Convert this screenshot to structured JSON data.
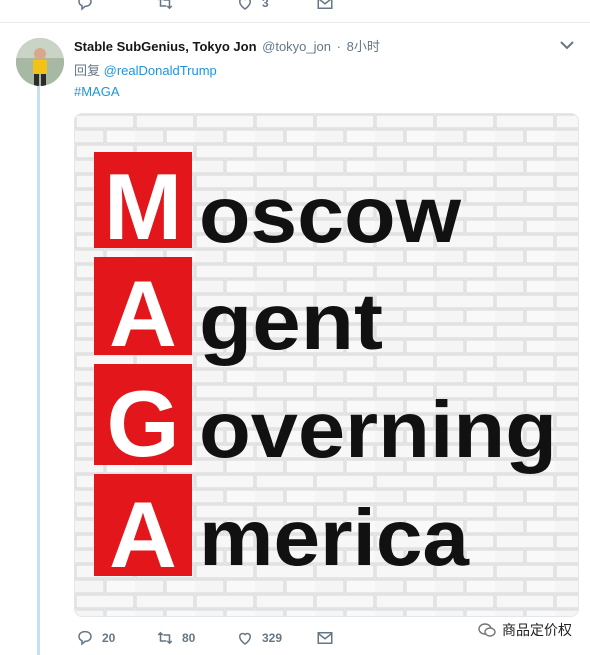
{
  "top_actions": {
    "reply_count": "",
    "retweet_count": "",
    "like_count": "3"
  },
  "tweet": {
    "display_name": "Stable SubGenius, Tokyo Jon",
    "handle": "@tokyo_jon",
    "separator": "·",
    "time": "8小时",
    "reply_prefix": "回复",
    "reply_to": "@realDonaldTrump",
    "hashtag": "#MAGA"
  },
  "image": {
    "letters": [
      "M",
      "A",
      "G",
      "A"
    ],
    "words": [
      "oscow",
      "gent",
      "overning",
      "merica"
    ],
    "colors": {
      "red": "#e3161b",
      "wall": "#eeeeee",
      "text": "#111111"
    }
  },
  "actions": {
    "reply_count": "20",
    "retweet_count": "80",
    "like_count": "329"
  },
  "watermark": {
    "text": "商品定价权"
  },
  "colors": {
    "accent": "#1b95e0",
    "muted": "#657786",
    "thread": "#c4dff6"
  }
}
